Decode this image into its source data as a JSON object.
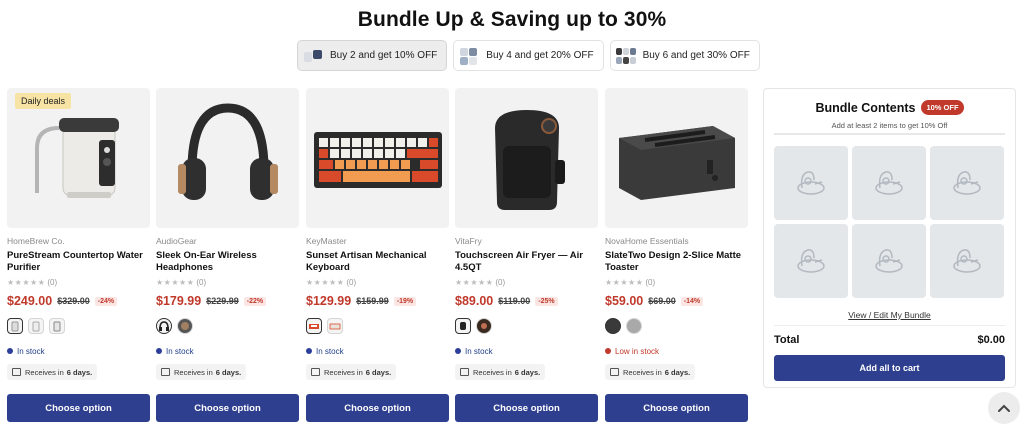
{
  "page": {
    "title": "Bundle Up & Saving up to 30%"
  },
  "tabs": [
    {
      "label": "Buy 2 and get 10% OFF",
      "active": true
    },
    {
      "label": "Buy 4 and get 20% OFF",
      "active": false
    },
    {
      "label": "Buy 6 and get 30% OFF",
      "active": false
    }
  ],
  "products": [
    {
      "badge": "Daily deals",
      "brand": "HomeBrew Co.",
      "name": "PureStream Countertop Water Purifier",
      "rating_count": "(0)",
      "price": "$249.00",
      "old_price": "$329.00",
      "discount": "-24%",
      "stock": "In stock",
      "receive_prefix": "Receives in",
      "receive_days": "6 days.",
      "button": "Choose option"
    },
    {
      "badge": "",
      "brand": "AudioGear",
      "name": "Sleek On-Ear Wireless Headphones",
      "rating_count": "(0)",
      "price": "$179.99",
      "old_price": "$229.99",
      "discount": "-22%",
      "stock": "In stock",
      "receive_prefix": "Receives in",
      "receive_days": "6 days.",
      "button": "Choose option"
    },
    {
      "badge": "",
      "brand": "KeyMaster",
      "name": "Sunset Artisan Mechanical Keyboard",
      "rating_count": "(0)",
      "price": "$129.99",
      "old_price": "$159.99",
      "discount": "-19%",
      "stock": "In stock",
      "receive_prefix": "Receives in",
      "receive_days": "6 days.",
      "button": "Choose option"
    },
    {
      "badge": "",
      "brand": "VitaFry",
      "name": "Touchscreen Air Fryer — Air 4.5QT",
      "rating_count": "(0)",
      "price": "$89.00",
      "old_price": "$119.00",
      "discount": "-25%",
      "stock": "In stock",
      "receive_prefix": "Receives in",
      "receive_days": "6 days.",
      "button": "Choose option"
    },
    {
      "badge": "",
      "brand": "NovaHome Essentials",
      "name": "SlateTwo Design 2-Slice Matte Toaster",
      "rating_count": "(0)",
      "price": "$59.00",
      "old_price": "$69.00",
      "discount": "-14%",
      "stock": "Low in stock",
      "receive_prefix": "Receives in",
      "receive_days": "6 days.",
      "button": "Choose option"
    }
  ],
  "bundle": {
    "title": "Bundle Contents",
    "badge": "10% OFF",
    "subtitle": "Add at least 2 items to get 10% Off",
    "view_link": "View / Edit My Bundle",
    "total_label": "Total",
    "total_value": "$0.00",
    "add_button": "Add all to cart"
  },
  "colors": {
    "primary": "#2f3f8f",
    "sale": "#c0392b",
    "deal_badge": "#f7e3a4",
    "in_stock": "#2c3e9a"
  },
  "icons": {
    "back_to_top": "chevron-up-icon",
    "slot": "placeholder-icon",
    "delivery": "truck-icon"
  }
}
